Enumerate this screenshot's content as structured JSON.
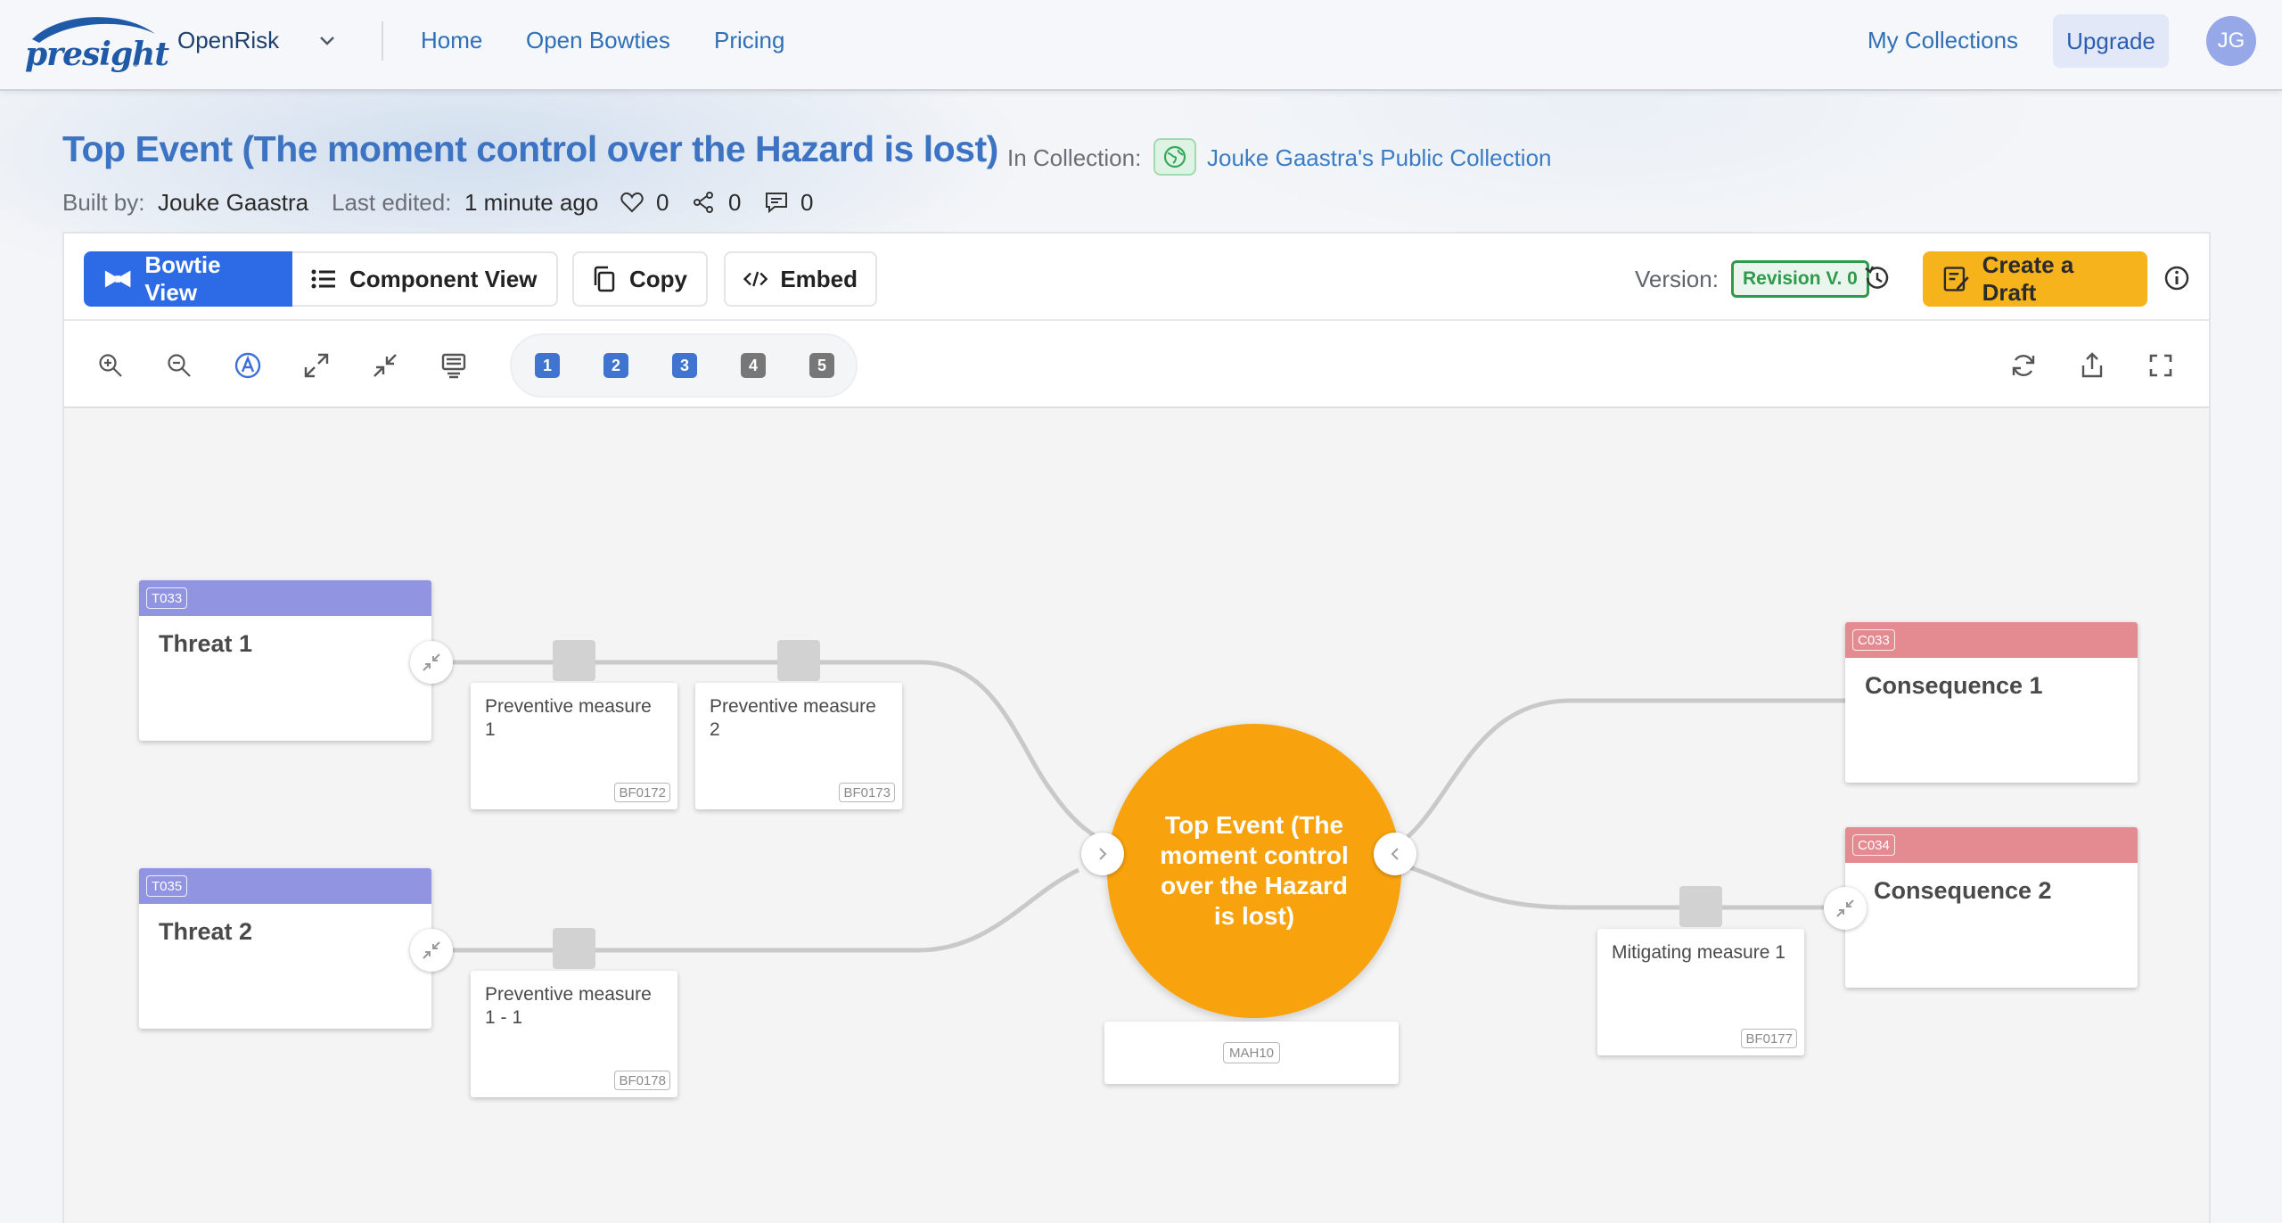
{
  "nav": {
    "logo_text": "presight",
    "brand": "OpenRisk",
    "links": [
      {
        "label": "Home"
      },
      {
        "label": "Open Bowties"
      },
      {
        "label": "Pricing"
      }
    ],
    "my_collections": "My Collections",
    "upgrade": "Upgrade",
    "avatar_initials": "JG"
  },
  "header": {
    "title": "Top Event (The moment control over the Hazard is lost)",
    "collection_label": "In Collection:",
    "collection_name": "Jouke Gaastra's Public Collection",
    "built_by_label": "Built by:",
    "built_by": "Jouke Gaastra",
    "last_edited_label": "Last edited:",
    "last_edited": "1 minute ago",
    "likes": "0",
    "shares": "0",
    "comments": "0"
  },
  "toolbar": {
    "bowtie_view": "Bowtie View",
    "component_view": "Component View",
    "copy": "Copy",
    "embed": "Embed",
    "version_label": "Version:",
    "revision": "Revision V. 0",
    "create_draft": "Create a Draft",
    "levels": [
      "1",
      "2",
      "3",
      "4",
      "5"
    ]
  },
  "diagram": {
    "threats": [
      {
        "code": "T033",
        "title": "Threat 1"
      },
      {
        "code": "T035",
        "title": "Threat 2"
      }
    ],
    "preventive_barriers": [
      {
        "title": "Preventive measure 1",
        "code": "BF0172"
      },
      {
        "title": "Preventive measure 2",
        "code": "BF0173"
      },
      {
        "title": "Preventive measure 1 - 1",
        "code": "BF0178"
      }
    ],
    "top_event": "Top Event (The moment control over the Hazard is lost)",
    "hazard_code": "MAH10",
    "mitigating_barriers": [
      {
        "title": "Mitigating measure 1",
        "code": "BF0177"
      }
    ],
    "consequences": [
      {
        "code": "C033",
        "title": "Consequence 1"
      },
      {
        "code": "C034",
        "title": "Consequence 2"
      }
    ]
  },
  "colors": {
    "primary_blue": "#2d6be6",
    "title_blue": "#3d73c3",
    "threat_header": "#9194e0",
    "consequence_header": "#e48b92",
    "top_event": "#f8a20d",
    "draft_button": "#f7b31c",
    "revision_green": "#2e9a4c"
  }
}
